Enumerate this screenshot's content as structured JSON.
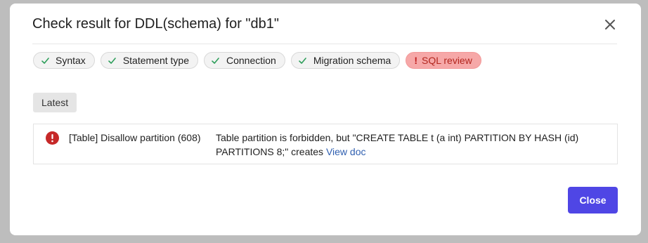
{
  "dialog": {
    "title": "Check result for DDL(schema) for \"db1\"",
    "close_icon": "close-icon"
  },
  "checks": [
    {
      "label": "Syntax",
      "status": "success",
      "icon": "check-icon"
    },
    {
      "label": "Statement type",
      "status": "success",
      "icon": "check-icon"
    },
    {
      "label": "Connection",
      "status": "success",
      "icon": "check-icon"
    },
    {
      "label": "Migration schema",
      "status": "success",
      "icon": "check-icon"
    },
    {
      "label": "SQL review",
      "status": "error",
      "icon": "exclamation-icon"
    }
  ],
  "latest_tag": "Latest",
  "result": {
    "icon": "error-circle-icon",
    "rule": "[Table] Disallow partition (608)",
    "message": "Table partition is forbidden, but \"CREATE TABLE t (a int) PARTITION BY HASH (id) PARTITIONS 8;\" creates",
    "link": "View doc"
  },
  "footer": {
    "close_label": "Close"
  },
  "colors": {
    "success": "#2e9e5b",
    "error": "#c01c1c",
    "error_chip_bg": "#f6a8a8",
    "primary_button": "#4f46e5",
    "link": "#2f5fb0"
  }
}
